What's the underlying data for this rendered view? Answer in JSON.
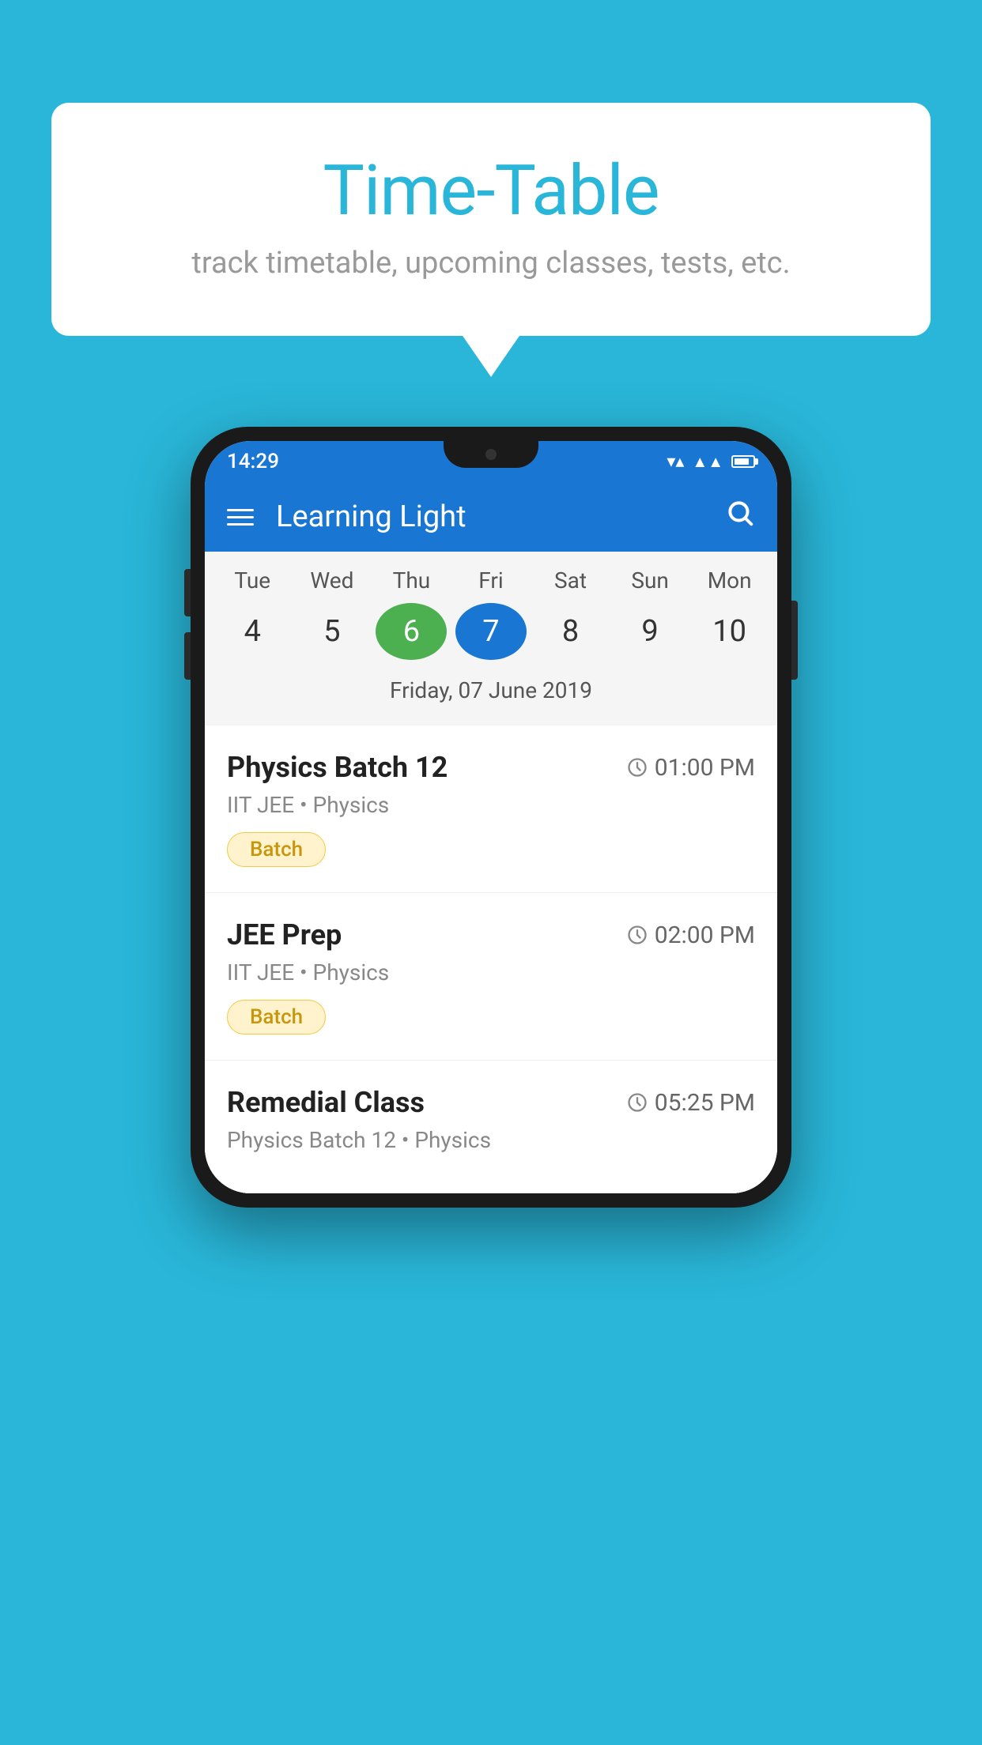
{
  "background_color": "#29B6D8",
  "speech_bubble": {
    "title": "Time-Table",
    "subtitle": "track timetable, upcoming classes, tests, etc."
  },
  "app": {
    "title": "Learning Light",
    "status_time": "14:29"
  },
  "calendar": {
    "days": [
      {
        "label": "Tue",
        "num": "4"
      },
      {
        "label": "Wed",
        "num": "5"
      },
      {
        "label": "Thu",
        "num": "6",
        "state": "today"
      },
      {
        "label": "Fri",
        "num": "7",
        "state": "selected"
      },
      {
        "label": "Sat",
        "num": "8"
      },
      {
        "label": "Sun",
        "num": "9"
      },
      {
        "label": "Mon",
        "num": "10"
      }
    ],
    "selected_date": "Friday, 07 June 2019"
  },
  "classes": [
    {
      "name": "Physics Batch 12",
      "time": "01:00 PM",
      "meta": "IIT JEE • Physics",
      "badge": "Batch"
    },
    {
      "name": "JEE Prep",
      "time": "02:00 PM",
      "meta": "IIT JEE • Physics",
      "badge": "Batch"
    },
    {
      "name": "Remedial Class",
      "time": "05:25 PM",
      "meta": "Physics Batch 12 • Physics",
      "badge": ""
    }
  ],
  "icons": {
    "menu": "☰",
    "search": "🔍",
    "clock": "🕐"
  }
}
